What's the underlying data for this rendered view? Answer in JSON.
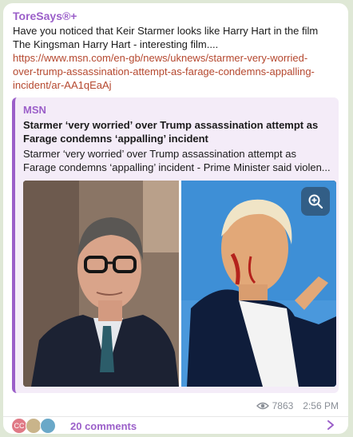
{
  "message": {
    "sender": "ToreSays®+",
    "text_lines": [
      "Have you noticed that Keir Starmer looks like Harry Hart in the film",
      "The Kingsman Harry Hart - interesting film...."
    ],
    "link_lines": [
      "https://www.msn.com/en-gb/news/uknews/starmer-very-worried-",
      "over-trump-assassination-attempt-as-farage-condemns-appalling-",
      "incident/ar-AA1qEaAj"
    ]
  },
  "preview": {
    "site": "MSN",
    "title_lines": [
      "Starmer ‘very worried’ over Trump assassination attempt as",
      "Farage condemns ‘appalling’ incident"
    ],
    "description_lines": [
      "Starmer ‘very worried’ over Trump assassination attempt as",
      "Farage condemns ‘appalling’ incident - Prime Minister said violen..."
    ],
    "image_icon": "zoom-in-icon"
  },
  "meta": {
    "views": "7863",
    "time": "2:56 PM",
    "views_icon": "eye-icon"
  },
  "comments": {
    "label": "20 comments",
    "avatars": [
      {
        "initials": "CC",
        "color": "#e07a86"
      },
      {
        "initials": "",
        "color": "#c9b48a"
      },
      {
        "initials": "",
        "color": "#6aa8c8"
      }
    ],
    "chevron_icon": "chevron-right-icon"
  },
  "colors": {
    "accent": "#9b5fc9",
    "link": "#b5482f",
    "background": "#dfe8d6"
  }
}
